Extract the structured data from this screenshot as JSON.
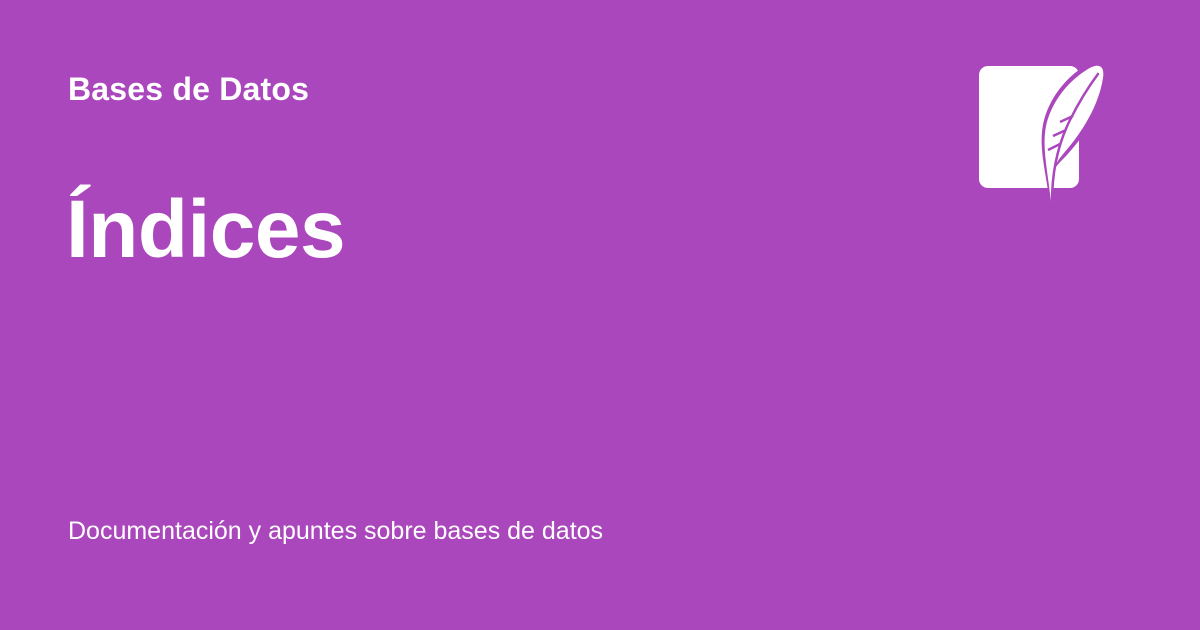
{
  "site": {
    "name": "Bases de Datos"
  },
  "page": {
    "title": "Índices",
    "description": "Documentación y apuntes sobre bases de datos"
  },
  "logo": {
    "icon": "database-feather-logo-icon"
  },
  "colors": {
    "background": "#ab47bc",
    "text": "#ffffff"
  }
}
